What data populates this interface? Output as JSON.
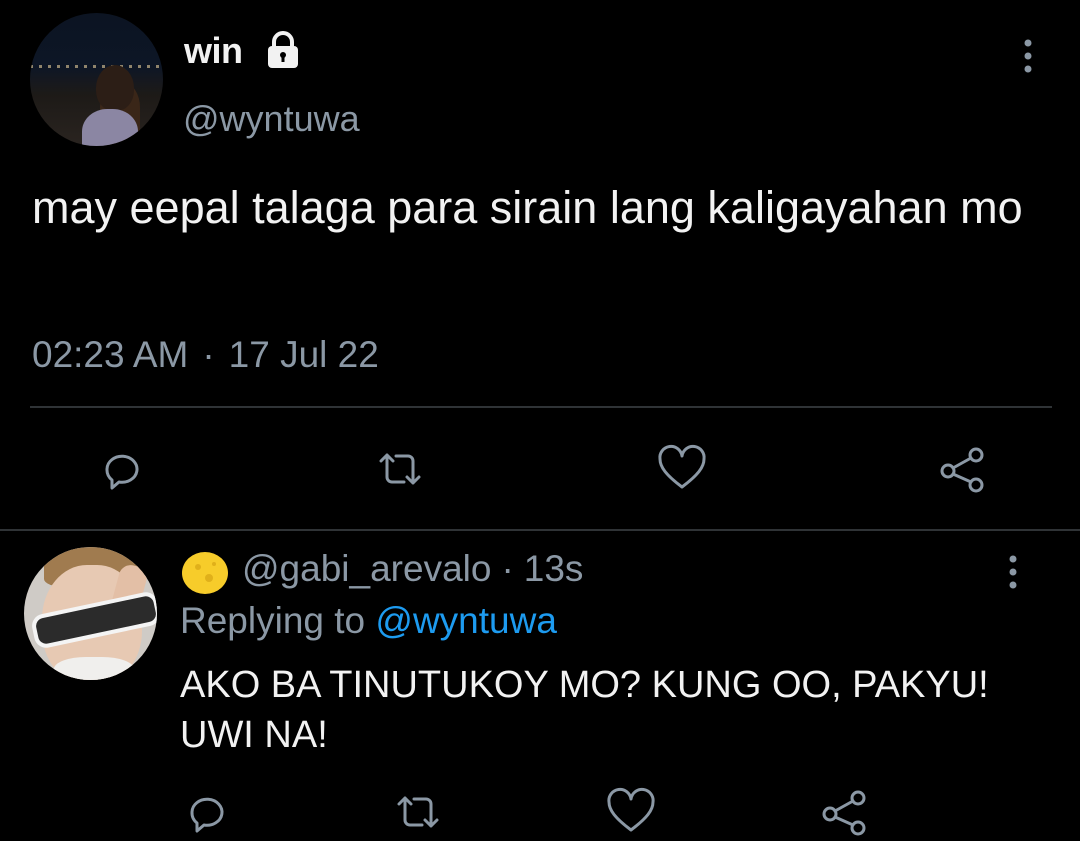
{
  "tweet": {
    "author_name": "win",
    "author_handle": "@wyntuwa",
    "text": "may eepal talaga para sirain lang kaligayahan mo",
    "time": "02:23 AM",
    "separator": "·",
    "date": "17 Jul 22",
    "avatar": "avatar-photo",
    "locked_icon": "lock-icon",
    "more_icon": "more-vertical-icon",
    "actions": [
      "reply-icon",
      "retweet-icon",
      "like-icon",
      "share-icon"
    ]
  },
  "reply": {
    "badge_icon": "crescent-moon-emoji",
    "author_handle": "@gabi_arevalo",
    "separator": "·",
    "time_ago": "13s",
    "replying_prefix": "Replying to",
    "replying_handle": "@wyntuwa",
    "text": "AKO BA TINUTUKOY MO? KUNG OO, PAKYU! UWI NA!",
    "more_icon": "more-vertical-icon",
    "actions": [
      "reply-icon",
      "retweet-icon",
      "like-icon",
      "share-icon"
    ]
  },
  "colors": {
    "background": "#000000",
    "primary_text": "#f2f2f2",
    "secondary_text": "#8b98a5",
    "link": "#1d9bf0",
    "divider": "#2f3336"
  }
}
